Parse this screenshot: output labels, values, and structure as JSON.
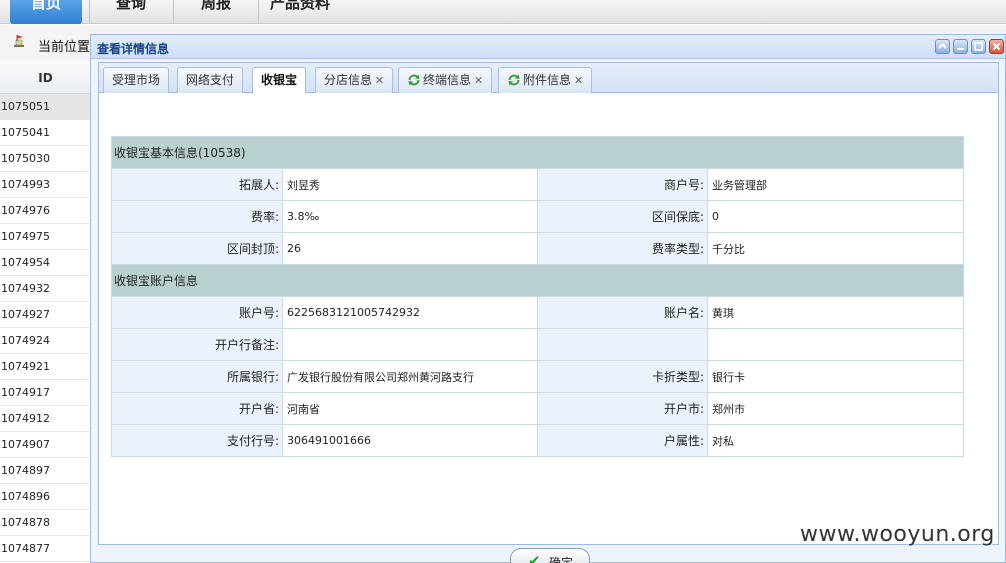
{
  "nav": {
    "tabs": [
      "首页",
      "查询",
      "周报",
      "产品资料"
    ]
  },
  "breadcrumb": {
    "label": "当前位置:"
  },
  "list": {
    "header": "ID",
    "ids": [
      "1075051",
      "1075041",
      "1075030",
      "1074993",
      "1074976",
      "1074975",
      "1074954",
      "1074932",
      "1074927",
      "1074924",
      "1074921",
      "1074917",
      "1074912",
      "1074907",
      "1074897",
      "1074896",
      "1074878",
      "1074877"
    ]
  },
  "dialog": {
    "title": "查看详情信息",
    "tabs": [
      {
        "label": "受理市场",
        "closable": false,
        "icon": ""
      },
      {
        "label": "网络支付",
        "closable": false,
        "icon": ""
      },
      {
        "label": "收银宝",
        "closable": false,
        "icon": "",
        "active": true
      },
      {
        "label": "分店信息",
        "closable": true,
        "icon": ""
      },
      {
        "label": "终端信息",
        "closable": true,
        "icon": "refresh-icon"
      },
      {
        "label": "附件信息",
        "closable": true,
        "icon": "refresh-icon"
      }
    ],
    "basic_section": "收银宝基本信息(10538)",
    "account_section": "收银宝账户信息",
    "rows": [
      {
        "l1": "拓展人:",
        "v1": "刘昱秀",
        "l2": "商户号:",
        "v2": "业务管理部"
      },
      {
        "l1": "费率:",
        "v1": "3.8‰",
        "l2": "区间保底:",
        "v2": "0"
      },
      {
        "l1": "区间封顶:",
        "v1": "26",
        "l2": "费率类型:",
        "v2": "千分比"
      }
    ],
    "account_rows": [
      {
        "l1": "账户号:",
        "v1": "6225683121005742932",
        "l2": "账户名:",
        "v2": "黄琪"
      },
      {
        "l1": "开户行备注:",
        "v1": "",
        "l2": "",
        "v2": ""
      },
      {
        "l1": "所属银行:",
        "v1": "广发银行股份有限公司郑州黄河路支行",
        "l2": "卡折类型:",
        "v2": "银行卡"
      },
      {
        "l1": "开户省:",
        "v1": "河南省",
        "l2": "开户市:",
        "v2": "郑州市"
      },
      {
        "l1": "支付行号:",
        "v1": "306491001666",
        "l2": "户属性:",
        "v2": "对私"
      }
    ],
    "confirm_label": "确定"
  },
  "watermark": "www.wooyun.org",
  "colors": {
    "section_bg": "#b9d0d0",
    "label_bg": "#eaf3fb",
    "title_text": "#15428b"
  }
}
